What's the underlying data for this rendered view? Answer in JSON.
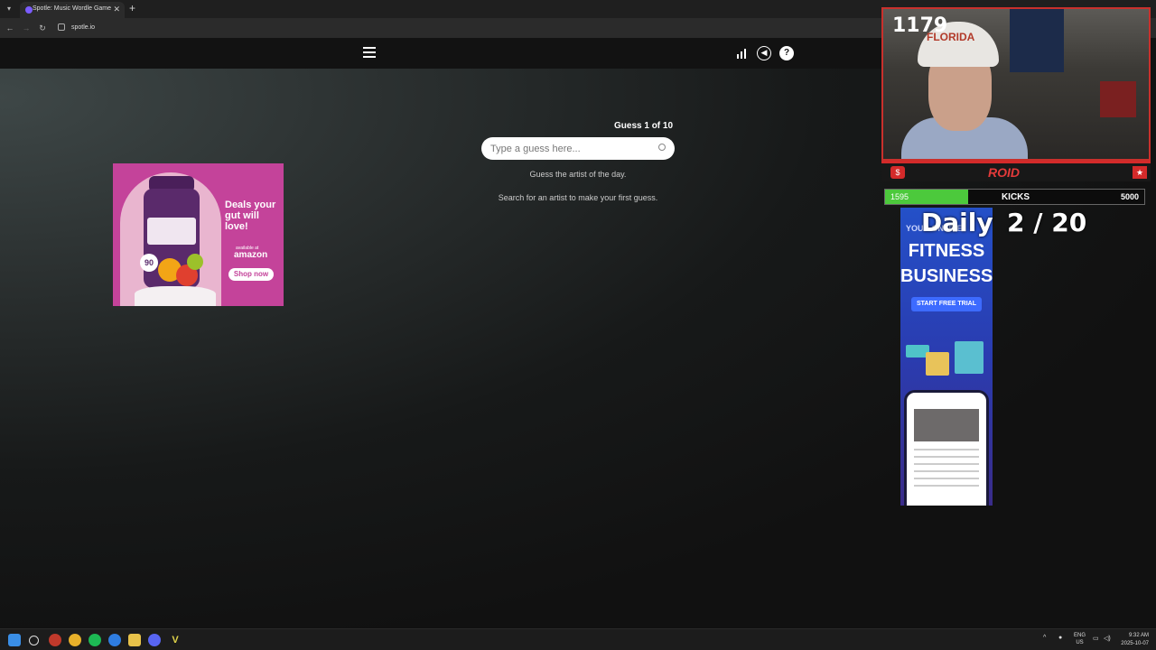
{
  "browser": {
    "tab_title": "Spotle: Music Wordle Game",
    "url": "spotle.io"
  },
  "game": {
    "guess_counter": "Guess 1 of 10",
    "input_placeholder": "Type a guess here...",
    "hint_primary": "Guess the artist of the day.",
    "hint_secondary": "Search for an artist to make your first guess."
  },
  "ad_left": {
    "product": "Restora FIBRE",
    "badge": "90",
    "headline": "Deals your gut will love!",
    "available_text": "available at",
    "retailer": "amazon",
    "cta": "Shop now",
    "background_color": "#c4439a"
  },
  "ad_right": {
    "pretitle": "YOUR ONLINE",
    "title": "FITNESS BUSINESS",
    "cta": "START FREE TRIAL"
  },
  "stream_overlay": {
    "score": "1179",
    "hat_text": "FLORIDA",
    "logo_center": "ROID",
    "kicks_current": "1595",
    "kicks_label": "KICKS",
    "kicks_goal": "5000",
    "kicks_progress": 0.319,
    "daily_label": "Daily",
    "daily_count": "2 / 20"
  },
  "taskbar": {
    "lang": "ENG",
    "region": "US",
    "time": "9:32 AM",
    "date": "2025-10-07"
  },
  "icons": {
    "hamburger": "menu-icon",
    "stats": "stats-icon",
    "sound": "speaker-icon",
    "help": "help-icon"
  }
}
